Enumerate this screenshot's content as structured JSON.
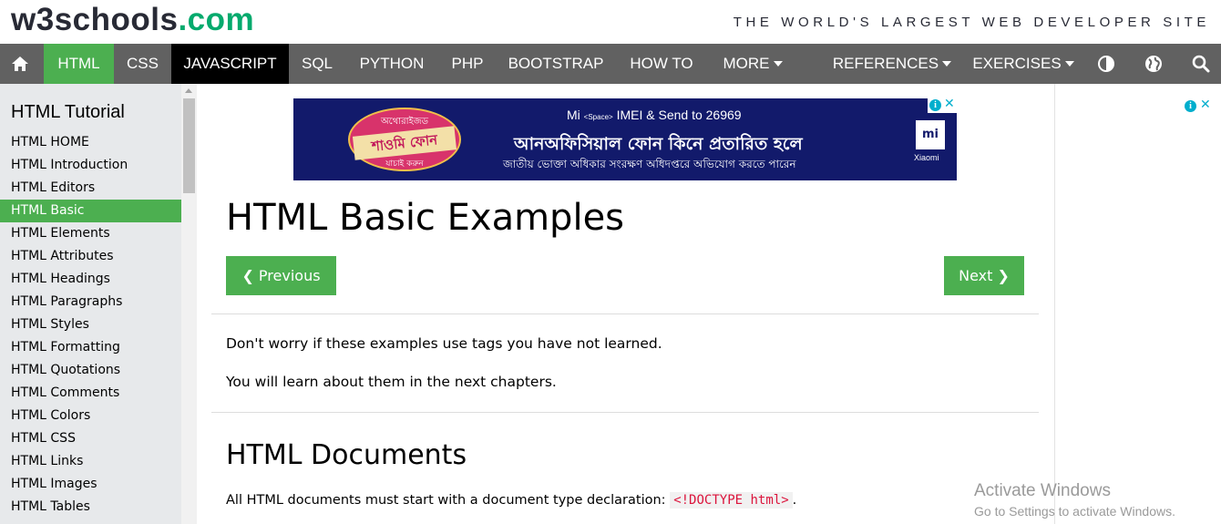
{
  "logo": {
    "w3": "w3schools",
    "com": ".com"
  },
  "tagline": "THE WORLD'S LARGEST WEB DEVELOPER SITE",
  "nav": {
    "items": [
      {
        "label": "HTML"
      },
      {
        "label": "CSS"
      },
      {
        "label": "JAVASCRIPT"
      },
      {
        "label": "SQL"
      },
      {
        "label": "PYTHON"
      },
      {
        "label": "PHP"
      },
      {
        "label": "BOOTSTRAP"
      },
      {
        "label": "HOW TO"
      },
      {
        "label": "MORE"
      },
      {
        "label": "REFERENCES"
      },
      {
        "label": "EXERCISES"
      }
    ],
    "icons": [
      "home-icon",
      "contrast-icon",
      "globe-icon",
      "search-icon"
    ]
  },
  "sidebar": {
    "title": "HTML Tutorial",
    "items": [
      {
        "label": "HTML HOME"
      },
      {
        "label": "HTML Introduction"
      },
      {
        "label": "HTML Editors"
      },
      {
        "label": "HTML Basic"
      },
      {
        "label": "HTML Elements"
      },
      {
        "label": "HTML Attributes"
      },
      {
        "label": "HTML Headings"
      },
      {
        "label": "HTML Paragraphs"
      },
      {
        "label": "HTML Styles"
      },
      {
        "label": "HTML Formatting"
      },
      {
        "label": "HTML Quotations"
      },
      {
        "label": "HTML Comments"
      },
      {
        "label": "HTML Colors"
      },
      {
        "label": "HTML CSS"
      },
      {
        "label": "HTML Links"
      },
      {
        "label": "HTML Images"
      },
      {
        "label": "HTML Tables"
      }
    ],
    "active_index": 3
  },
  "ad": {
    "badge_top": "অথোরাইজড",
    "badge_main": "শাওমি ফোন",
    "badge_bottom": "যাচাই করুন",
    "line1": "Mi",
    "line1_small": "<Space>",
    "line1_rest": "IMEI & Send to 26969",
    "line2": "আনঅফিসিয়াল ফোন কিনে প্রতারিত হলে",
    "line3": "জাতীয় ভোক্তা অধিকার সংরক্ষণ অধিদপ্তরে অভিযোগ করতে পারেন",
    "mi_logo": "mi",
    "brand": "Xiaomi",
    "info": "i",
    "close": "✕"
  },
  "main": {
    "title": "HTML Basic Examples",
    "prev_label": "❮ Previous",
    "next_label": "Next ❯",
    "para1": "Don't worry if these examples use tags you have not learned.",
    "para2": "You will learn about them in the next chapters.",
    "h2": "HTML Documents",
    "para3": "All HTML documents must start with a document type declaration:",
    "code": "<!DOCTYPE html>",
    "para3_end": "."
  },
  "watermark": {
    "line1": "Activate Windows",
    "line2": "Go to Settings to activate Windows."
  },
  "colors": {
    "brand_green": "#04aa6d",
    "nav_bg": "#616161",
    "active_green": "#4caf50",
    "sidebar_bg": "#e7e9eb"
  }
}
